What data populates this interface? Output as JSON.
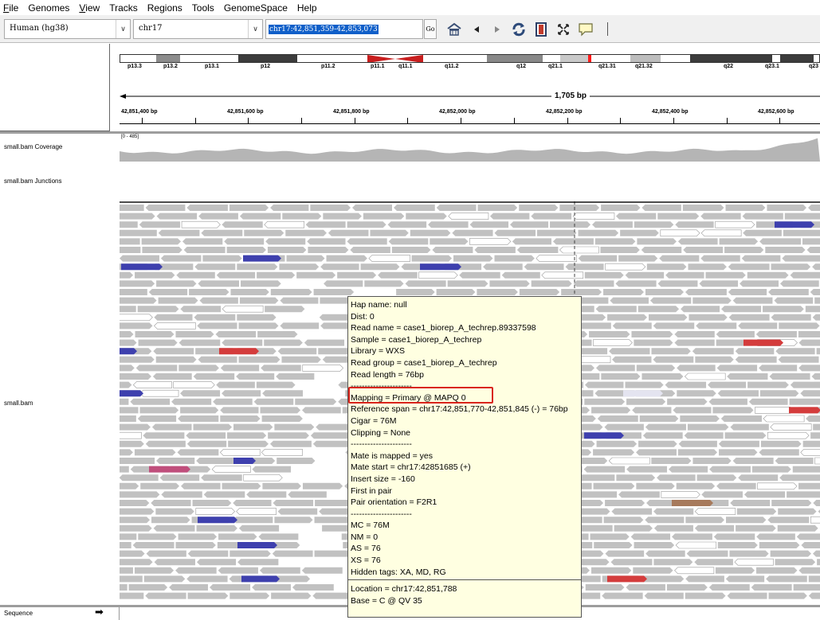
{
  "menu": [
    {
      "label": "File",
      "ul": "F",
      "rest": "ile"
    },
    {
      "label": "Genomes",
      "ul": "",
      "rest": "Genomes"
    },
    {
      "label": "View",
      "ul": "V",
      "rest": "iew"
    },
    {
      "label": "Tracks",
      "ul": "",
      "rest": "Tracks"
    },
    {
      "label": "Regions",
      "ul": "",
      "rest": "Regions"
    },
    {
      "label": "Tools",
      "ul": "",
      "rest": "Tools"
    },
    {
      "label": "GenomeSpace",
      "ul": "",
      "rest": "GenomeSpace"
    },
    {
      "label": "Help",
      "ul": "",
      "rest": "Help"
    }
  ],
  "toolbar": {
    "genome": "Human (hg38)",
    "chromosome": "chr17",
    "locus": "chr17:42,851,359-42,853,073",
    "go_label": "Go",
    "icons": [
      "home-icon",
      "back-icon",
      "forward-icon",
      "refresh-icon",
      "roi-icon",
      "resize-icon",
      "popup-info-icon"
    ]
  },
  "ideogram": {
    "bands": [
      "p13.3",
      "p13.2",
      "p13.1",
      "p12",
      "p11.2",
      "p11.1",
      "q11.1",
      "q11.2",
      "q12",
      "q21.1",
      "q21.31",
      "q21.32",
      "q22",
      "q23.1",
      "q23"
    ]
  },
  "ruler": {
    "span": "1,705 bp",
    "ticks": [
      "42,851,400 bp",
      "42,851,600 bp",
      "42,851,800 bp",
      "42,852,000 bp",
      "42,852,200 bp",
      "42,852,400 bp",
      "42,852,600 bp"
    ]
  },
  "tracks": {
    "coverage_label": "small.bam Coverage",
    "coverage_range": "[0 - 485]",
    "junctions_label": "small.bam Junctions",
    "bam_label": "small.bam",
    "sequence_label": "Sequence",
    "sequence_arrow": "➡"
  },
  "colors": {
    "read": "#c1c1c1",
    "read_white": "#ffffff",
    "read_blue": "#3e40ae",
    "read_red": "#d43c3c",
    "read_pink": "#c04e7c",
    "read_brown": "#a77a5c",
    "coverage": "#b5b5b5",
    "highlight": "#d9251d"
  },
  "popup": {
    "lines": [
      "Hap name: null",
      "Dist: 0",
      "Read name = case1_biorep_A_techrep.89337598",
      "Sample = case1_biorep_A_techrep",
      "Library = WXS",
      "Read group = case1_biorep_A_techrep",
      "Read length = 76bp",
      "----------------------",
      "Mapping = Primary @ MAPQ 0",
      "Reference span = chr17:42,851,770-42,851,845 (-) = 76bp",
      "Cigar = 76M",
      "Clipping = None",
      "----------------------",
      "Mate is mapped = yes",
      "Mate start = chr17:42851685 (+)",
      "Insert size = -160",
      "First in pair",
      "Pair orientation = F2R1",
      "----------------------",
      "MC = 76M",
      "NM = 0",
      "AS = 76",
      "XS = 76",
      "Hidden tags: XA, MD, RG"
    ],
    "footer_lines": [
      "Location = chr17:42,851,788",
      "Base = C @ QV 35"
    ]
  }
}
